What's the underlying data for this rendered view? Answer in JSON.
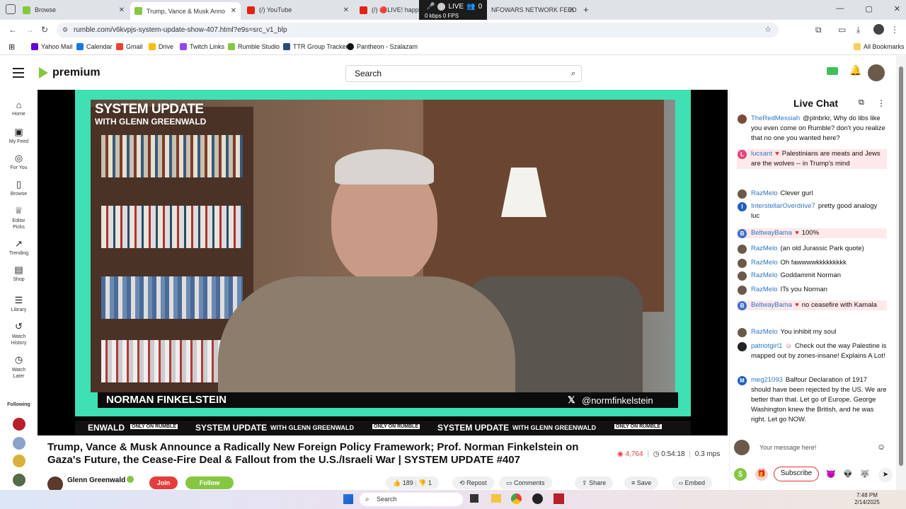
{
  "browser": {
    "tabs": [
      {
        "label": "Browse",
        "color": "#85c742"
      },
      {
        "label": "Trump, Vance & Musk Anno",
        "color": "#85c742",
        "active": true
      },
      {
        "label": "(/) YouTube",
        "color": "#e62117"
      },
      {
        "label": "(/) 🔴LIVE! happy",
        "color": "#e62117"
      },
      {
        "label": "NFOWARS NETWORK FEED",
        "color": "#e62117"
      }
    ],
    "url": "rumble.com/v6kvpjs-system-update-show-407.html?e9s=src_v1_blp",
    "live_overlay": {
      "status": "LIVE",
      "viewers": "0",
      "stats": "0 kbps 0 FPS"
    },
    "bookmarks": [
      {
        "label": "Yahoo Mail",
        "color": "#6001d2"
      },
      {
        "label": "Calendar",
        "color": "#1a73e8"
      },
      {
        "label": "Gmail",
        "color": "#ea4335"
      },
      {
        "label": "Drive",
        "color": "#fbbc04"
      },
      {
        "label": "Twitch Links",
        "color": "#9146ff"
      },
      {
        "label": "Rumble Studio",
        "color": "#85c742"
      },
      {
        "label": "TTR Group Tracker",
        "color": "#2b4a7a"
      },
      {
        "label": "Pantheon - Szalazam",
        "color": "#111111"
      }
    ],
    "all_bookmarks": "All Bookmarks"
  },
  "header": {
    "logo_text": "premium",
    "search_placeholder": "Search"
  },
  "leftnav": {
    "items": [
      {
        "label": "Home",
        "icon": "⌂"
      },
      {
        "label": "My Feed",
        "icon": "▣"
      },
      {
        "label": "For You",
        "icon": "◎"
      },
      {
        "label": "Browse",
        "icon": "▯"
      },
      {
        "label": "Editor Picks",
        "icon": "♕"
      },
      {
        "label": "Trending",
        "icon": "↗"
      },
      {
        "label": "Shop",
        "icon": "▤"
      },
      {
        "label": "Library",
        "icon": "☰"
      },
      {
        "label": "Watch History",
        "icon": "↺"
      },
      {
        "label": "Watch Later",
        "icon": "◷"
      }
    ],
    "following_label": "Following"
  },
  "video": {
    "show_title": "SYSTEM UPDATE",
    "show_subtitle": "WITH GLENN GREENWALD",
    "guest_name": "NORMAN FINKELSTEIN",
    "guest_handle": "@normfinkelstein",
    "ticker_segments": [
      {
        "a": "ENWALD",
        "b": "ONLY ON RUMBLE"
      },
      {
        "a": "SYSTEM UPDATE",
        "sub": "WITH GLENN GREENWALD",
        "b": "ONLY ON RUMBLE"
      },
      {
        "a": "SYSTEM UPDATE",
        "sub": "WITH GLENN GREENWALD",
        "b": "ONLY ON RUMBLE"
      }
    ]
  },
  "info": {
    "title": "Trump, Vance & Musk Announce a Radically New Foreign Policy Framework; Prof. Norman Finkelstein on Gaza's Future, the Cease-Fire Deal & Fallout from the U.S./Israeli War | SYSTEM UPDATE #407",
    "views": "4,764",
    "duration": "0:54:18",
    "bitrate": "0.3 mps",
    "channel": "Glenn Greenwald",
    "join_label": "Join",
    "follow_label": "Follow",
    "likes": "189",
    "dislikes": "1",
    "actions": [
      "Repost",
      "Comments",
      "Share",
      "Save",
      "Embed"
    ]
  },
  "chat": {
    "title": "Live Chat",
    "messages": [
      {
        "user": "TheRedMessiah",
        "text": "@plnbrkr, Why do libs like you even come on Rumble? don't you realize that no one you wanted here?",
        "av": "#7a4b3a",
        "initial": ""
      },
      {
        "user": "lucsant",
        "badge": "♥",
        "text": "Palestinians are meats and Jews are the wolves -- in Trump's mind",
        "av": "#e0457b",
        "initial": "L",
        "highlight": true
      },
      {
        "user": "RazMelo",
        "text": "Clever gurl",
        "av": "#6b5a4a",
        "initial": ""
      },
      {
        "user": "InterstellarOverdrive7",
        "text": "pretty good analogy luc",
        "av": "#1f5fbf",
        "initial": "I"
      },
      {
        "user": "BeltwayBama",
        "badge": "♥",
        "text": "100%",
        "av": "#3f6fd1",
        "initial": "B",
        "highlight": true
      },
      {
        "user": "RazMelo",
        "text": "(an old Jurassic Park quote)",
        "av": "#6b5a4a",
        "initial": ""
      },
      {
        "user": "RazMelo",
        "text": "Oh fawwwwkkkkkkkkk",
        "av": "#6b5a4a",
        "initial": ""
      },
      {
        "user": "RazMelo",
        "text": "Goddammit Norman",
        "av": "#6b5a4a",
        "initial": ""
      },
      {
        "user": "RazMelo",
        "text": "ITs you Norman",
        "av": "#6b5a4a",
        "initial": ""
      },
      {
        "user": "BeltwayBama",
        "badge": "♥",
        "text": "no ceasefire with Kamala",
        "av": "#3f6fd1",
        "initial": "B",
        "highlight": true
      },
      {
        "user": "RazMelo",
        "text": "You inhibit my soul",
        "av": "#6b5a4a",
        "initial": ""
      },
      {
        "user": "patriotgirl1",
        "badge": "☺",
        "text": "Check out the way Palestine is mapped out by zones-insane! Explains A Lot!",
        "av": "#222222",
        "initial": ""
      },
      {
        "user": "meg21093",
        "text": "Balfour Declaration of 1917 should have been rejected by the US. We are better than that. Let go of Europe. George Washington knew the British, and he was right. Let go NOW.",
        "av": "#1f5fbf",
        "initial": "M"
      }
    ],
    "input_placeholder": "Your message here!",
    "subscribe_label": "Subscribe"
  },
  "taskbar": {
    "search_label": "Search",
    "time": "7:48 PM",
    "date": "2/14/2025"
  },
  "colors": {
    "rumble_green": "#85c742",
    "frame_teal": "#3fe0b4",
    "username_blue": "#2f76c3",
    "join_red": "#e63c3c"
  }
}
